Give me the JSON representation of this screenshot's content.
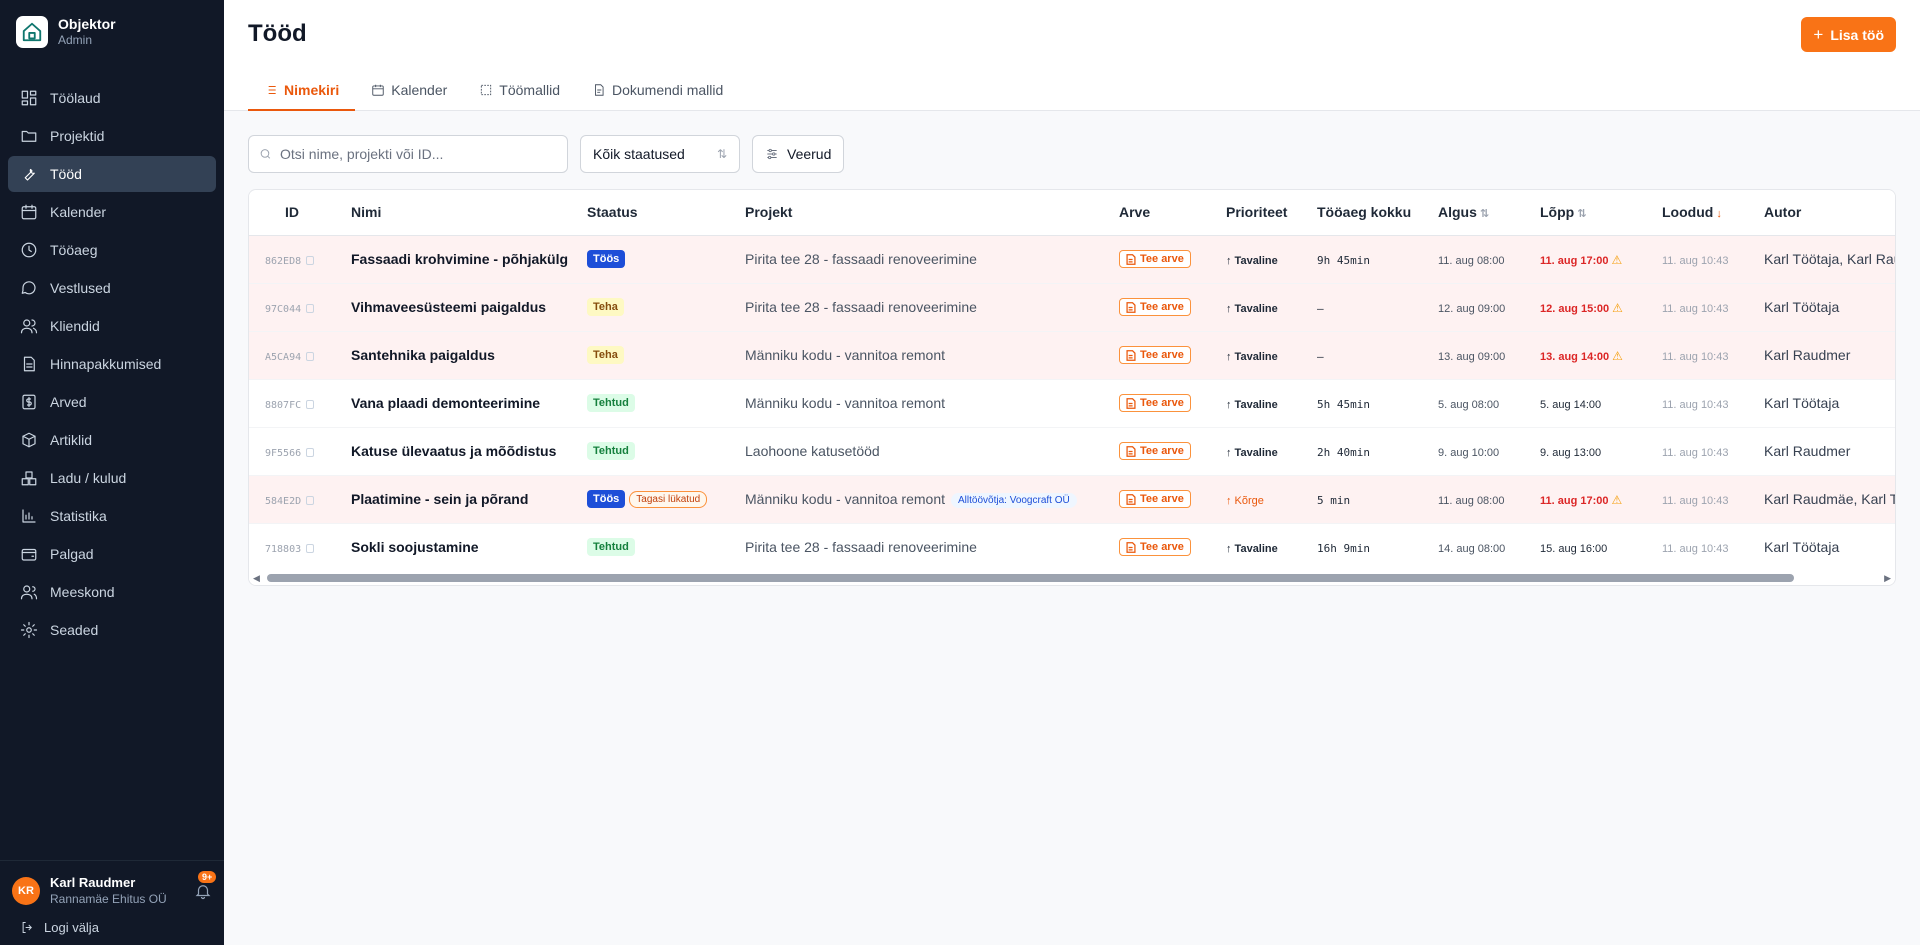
{
  "app": {
    "name": "Objektor",
    "role": "Admin"
  },
  "sidebar": {
    "items": [
      {
        "label": "Töölaud",
        "icon": "dashboard-icon"
      },
      {
        "label": "Projektid",
        "icon": "folder-icon"
      },
      {
        "label": "Tööd",
        "icon": "wrench-icon",
        "active": true
      },
      {
        "label": "Kalender",
        "icon": "calendar-icon"
      },
      {
        "label": "Tööaeg",
        "icon": "clock-icon"
      },
      {
        "label": "Vestlused",
        "icon": "chat-icon"
      },
      {
        "label": "Kliendid",
        "icon": "users-icon"
      },
      {
        "label": "Hinnapakkumised",
        "icon": "document-icon"
      },
      {
        "label": "Arved",
        "icon": "invoice-icon"
      },
      {
        "label": "Artiklid",
        "icon": "box-icon"
      },
      {
        "label": "Ladu / kulud",
        "icon": "boxes-icon"
      },
      {
        "label": "Statistika",
        "icon": "chart-icon"
      },
      {
        "label": "Palgad",
        "icon": "wallet-icon"
      },
      {
        "label": "Meeskond",
        "icon": "team-icon"
      },
      {
        "label": "Seaded",
        "icon": "gear-icon"
      }
    ]
  },
  "user": {
    "initials": "KR",
    "name": "Karl Raudmer",
    "company": "Rannamäe Ehitus OÜ",
    "notifications": "9+",
    "logout": "Logi välja"
  },
  "header": {
    "title": "Tööd",
    "add_button": "Lisa töö",
    "tabs": [
      {
        "label": "Nimekiri",
        "icon": "list-icon",
        "active": true
      },
      {
        "label": "Kalender",
        "icon": "calendar-icon"
      },
      {
        "label": "Töömallid",
        "icon": "template-icon"
      },
      {
        "label": "Dokumendi mallid",
        "icon": "file-icon"
      }
    ]
  },
  "toolbar": {
    "search_placeholder": "Otsi nime, projekti või ID...",
    "status_filter": "Kõik staatused",
    "columns_button": "Veerud"
  },
  "table": {
    "headers": {
      "id": "ID",
      "name": "Nimi",
      "status": "Staatus",
      "project": "Projekt",
      "invoice": "Arve",
      "priority": "Prioriteet",
      "time": "Tööaeg kokku",
      "start": "Algus",
      "end": "Lõpp",
      "created": "Loodud",
      "author": "Autor"
    },
    "rows": [
      {
        "id": "862ED8",
        "name": "Fassaadi krohvimine - põhjakülg",
        "status": "Töös",
        "status_kind": "toos",
        "project": "Pirita tee 28 - fassaadi renoveerimine",
        "invoice": "Tee arve",
        "priority": "↑ Tavaline",
        "time": "9h 45min",
        "start": "11. aug 08:00",
        "end": "11. aug 17:00",
        "late": true,
        "created": "11. aug 10:43",
        "author": "Karl Töötaja, Karl Raudmer"
      },
      {
        "id": "97C044",
        "name": "Vihmaveesüsteemi paigaldus",
        "status": "Teha",
        "status_kind": "teha",
        "project": "Pirita tee 28 - fassaadi renoveerimine",
        "invoice": "Tee arve",
        "priority": "↑ Tavaline",
        "time": "–",
        "start": "12. aug 09:00",
        "end": "12. aug 15:00",
        "late": true,
        "created": "11. aug 10:43",
        "author": "Karl Töötaja"
      },
      {
        "id": "A5CA94",
        "name": "Santehnika paigaldus",
        "status": "Teha",
        "status_kind": "teha",
        "project": "Männiku kodu - vannitoa remont",
        "invoice": "Tee arve",
        "priority": "↑ Tavaline",
        "time": "–",
        "start": "13. aug 09:00",
        "end": "13. aug 14:00",
        "late": true,
        "created": "11. aug 10:43",
        "author": "Karl Raudmer"
      },
      {
        "id": "8807FC",
        "name": "Vana plaadi demonteerimine",
        "status": "Tehtud",
        "status_kind": "tehtud",
        "project": "Männiku kodu - vannitoa remont",
        "invoice": "Tee arve",
        "priority": "↑ Tavaline",
        "time": "5h 45min",
        "start": "5. aug 08:00",
        "end": "5. aug 14:00",
        "late": false,
        "created": "11. aug 10:43",
        "author": "Karl Töötaja"
      },
      {
        "id": "9F5566",
        "name": "Katuse ülevaatus ja mõõdistus",
        "status": "Tehtud",
        "status_kind": "tehtud",
        "project": "Laohoone katusetööd",
        "invoice": "Tee arve",
        "priority": "↑ Tavaline",
        "time": "2h 40min",
        "start": "9. aug 10:00",
        "end": "9. aug 13:00",
        "late": false,
        "created": "11. aug 10:43",
        "author": "Karl Raudmer"
      },
      {
        "id": "584E2D",
        "name": "Plaatimine - sein ja põrand",
        "status": "Töös",
        "status_kind": "toos",
        "extra_tag": "Tagasi lükatud",
        "project": "Männiku kodu - vannitoa remont",
        "subcontractor": "Alltöövõtja: Voogcraft OÜ",
        "invoice": "Tee arve",
        "priority": "↑ Kõrge",
        "priority_high": true,
        "time": "5 min",
        "start": "11. aug 08:00",
        "end": "11. aug 17:00",
        "late": true,
        "created": "11. aug 10:43",
        "author": "Karl Raudmäe, Karl Töötaja"
      },
      {
        "id": "718803",
        "name": "Sokli soojustamine",
        "status": "Tehtud",
        "status_kind": "tehtud",
        "project": "Pirita tee 28 - fassaadi renoveerimine",
        "invoice": "Tee arve",
        "priority": "↑ Tavaline",
        "time": "16h 9min",
        "start": "14. aug 08:00",
        "end": "15. aug 16:00",
        "late": false,
        "created": "11. aug 10:43",
        "author": "Karl Töötaja"
      }
    ]
  },
  "colors": {
    "accent": "#f97316",
    "sidebar_bg": "#111827",
    "late_row": "#fef2f2",
    "status_toos": "#1d4ed8"
  }
}
